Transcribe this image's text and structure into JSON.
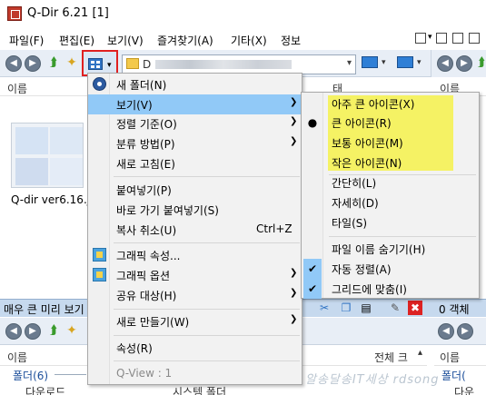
{
  "window": {
    "title": "Q-Dir 6.21 [1]"
  },
  "menubar": {
    "items": [
      {
        "label": "파일(F)"
      },
      {
        "label": "편집(E)"
      },
      {
        "label": "보기(V)"
      },
      {
        "label": "즐겨찾기(A)"
      },
      {
        "label": "기타(X)"
      },
      {
        "label": "정보"
      }
    ]
  },
  "toolbar": {
    "address_prefix": "D",
    "back_icon": "back-arrow-icon",
    "forward_icon": "forward-arrow-icon",
    "up_icon": "folder-up-icon",
    "newfolder_icon": "new-folder-icon",
    "view_icon": "view-mode-grid-icon"
  },
  "pane_top_left": {
    "col_name": "이름",
    "col_tag": "태그",
    "thumb_label": "Q-dir ver6.16.jp"
  },
  "status": {
    "left": "매우 큰 미리 보기",
    "right": "0 객체"
  },
  "pane_bottom_left": {
    "col_name": "이름",
    "col_total": "전체 크",
    "group": "폴더(6)",
    "row_name": "다운로드",
    "row_type": "시스템 폴더"
  },
  "pane_bottom_right": {
    "col_name": "이름",
    "group": "폴더(",
    "row_name": "다운"
  },
  "watermark": "알송달송IT세상 rdsong",
  "context_menu": {
    "items": [
      {
        "label": "새 폴더(N)"
      },
      {
        "label": "보기(V)"
      },
      {
        "label": "정렬 기준(O)"
      },
      {
        "label": "분류 방법(P)"
      },
      {
        "label": "새로 고침(E)"
      },
      {
        "label": "붙여넣기(P)"
      },
      {
        "label": "바로 가기 붙여넣기(S)"
      },
      {
        "label": "복사 취소(U)",
        "shortcut": "Ctrl+Z"
      },
      {
        "label": "그래픽 속성..."
      },
      {
        "label": "그래픽 옵션"
      },
      {
        "label": "공유 대상(H)"
      },
      {
        "label": "새로 만들기(W)"
      },
      {
        "label": "속성(R)"
      },
      {
        "label": "Q-View : 1"
      }
    ]
  },
  "view_submenu": {
    "items": [
      {
        "label": "아주 큰 아이콘(X)"
      },
      {
        "label": "큰 아이콘(R)"
      },
      {
        "label": "보통 아이콘(M)"
      },
      {
        "label": "작은 아이콘(N)"
      },
      {
        "label": "간단히(L)"
      },
      {
        "label": "자세히(D)"
      },
      {
        "label": "타일(S)"
      },
      {
        "label": "파일 이름 숨기기(H)"
      },
      {
        "label": "자동 정렬(A)"
      },
      {
        "label": "그리드에 맞춤(I)"
      }
    ],
    "highlight_color": "#f5f264",
    "selected": "큰 아이콘(R)"
  }
}
